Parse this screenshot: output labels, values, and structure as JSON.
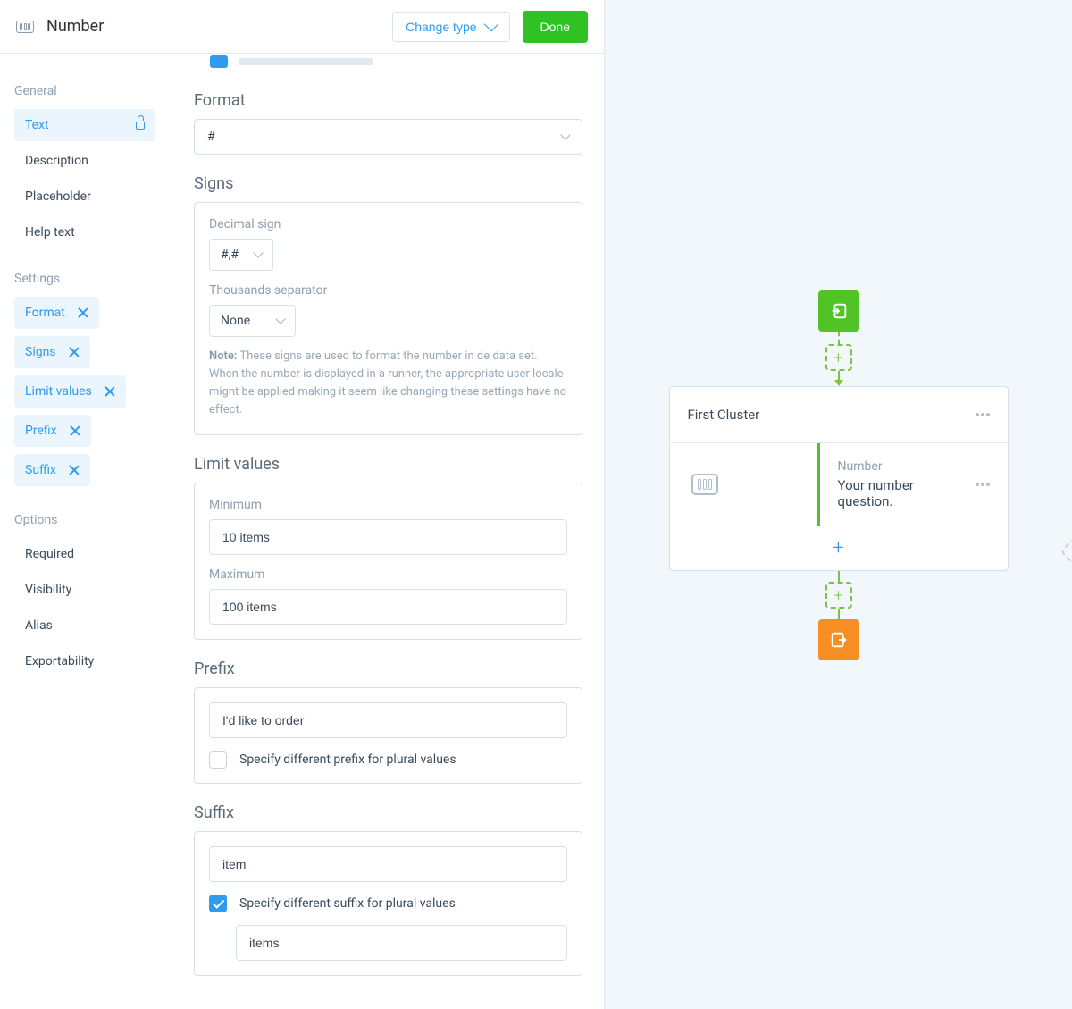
{
  "header": {
    "title": "Number",
    "change_type": "Change type",
    "done": "Done"
  },
  "sidebar": {
    "general_heading": "General",
    "general": [
      {
        "label": "Text",
        "active": true,
        "locked": true
      },
      {
        "label": "Description"
      },
      {
        "label": "Placeholder"
      },
      {
        "label": "Help text"
      }
    ],
    "settings_heading": "Settings",
    "settings": [
      {
        "label": "Format"
      },
      {
        "label": "Signs"
      },
      {
        "label": "Limit values"
      },
      {
        "label": "Prefix"
      },
      {
        "label": "Suffix"
      }
    ],
    "options_heading": "Options",
    "options": [
      {
        "label": "Required"
      },
      {
        "label": "Visibility"
      },
      {
        "label": "Alias"
      },
      {
        "label": "Exportability"
      }
    ]
  },
  "form": {
    "format": {
      "title": "Format",
      "value": "#"
    },
    "signs": {
      "title": "Signs",
      "decimal_label": "Decimal sign",
      "decimal_value": "#,#",
      "thousands_label": "Thousands separator",
      "thousands_value": "None",
      "note_label": "Note:",
      "note_text": " These signs are used to format the number in de data set. When the number is displayed in a runner, the appropriate user locale might be applied making it seem like changing these settings have no effect."
    },
    "limits": {
      "title": "Limit values",
      "min_label": "Minimum",
      "min_value": "10 items",
      "max_label": "Maximum",
      "max_value": "100 items"
    },
    "prefix": {
      "title": "Prefix",
      "value": "I'd like to order",
      "plural_label": "Specify different prefix for plural values"
    },
    "suffix": {
      "title": "Suffix",
      "value": "item",
      "plural_label": "Specify different suffix for plural values",
      "plural_value": "items"
    }
  },
  "canvas": {
    "cluster_title": "First Cluster",
    "block_type": "Number",
    "block_text": "Your number question."
  }
}
